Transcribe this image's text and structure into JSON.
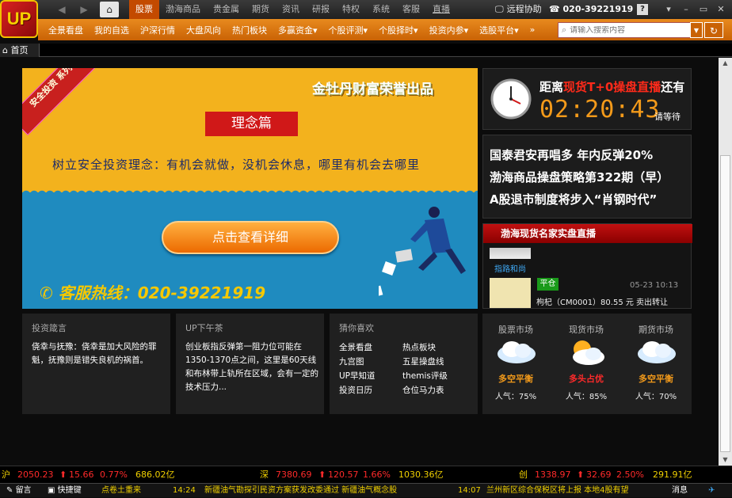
{
  "app": {
    "logo": "UP"
  },
  "topmenu": [
    "股票",
    "渤海商品",
    "贵金属",
    "期货",
    "资讯",
    "研报",
    "特权",
    "系统",
    "客服",
    "直播"
  ],
  "header": {
    "remote": "远程协助",
    "phone": "020-39221919",
    "help": "?"
  },
  "window_controls": [
    "▾",
    "–",
    "▭",
    "✕"
  ],
  "toolbar": [
    "全景看盘",
    "我的自选",
    "沪深行情",
    "大盘风向",
    "热门板块",
    "多赢资金▾",
    "个股评测▾",
    "个股择时▾",
    "投资内参▾",
    "选股平台▾",
    "»"
  ],
  "search": {
    "placeholder": "请输入搜索内容"
  },
  "tabs": {
    "home": "首页"
  },
  "banner": {
    "corner": "安全投资 系列",
    "subtitle": "金牡丹财富荣誉出品",
    "title": "理念篇",
    "slogan": "树立安全投资理念：有机会就做，没机会休息，哪里有机会去哪里",
    "cta": "点击查看详细",
    "hotline": "客服热线：020-39221919"
  },
  "countdown": {
    "prefix": "距离",
    "highlight": "现货T+0操盘直播",
    "suffix": "还有",
    "time": "02:20:43",
    "wait": "请等待"
  },
  "news": [
    "国泰君安再唱多 年内反弹20%",
    "渤海商品操盘策略第322期（早）",
    "A股退市制度将步入“肖钢时代”"
  ],
  "live": {
    "header": "渤海现货名家实盘直播",
    "name1": "指路和尚",
    "tag": "平仓",
    "time": "05-23 10:13",
    "message": "枸杞（CM0001）80.55 元 卖出转让"
  },
  "cards": {
    "quote": {
      "title": "投资箴言",
      "text": "侥幸与抚豫：侥幸是加大风险的罪魁，抚豫则是错失良机的祸首。"
    },
    "tea": {
      "title": "UP下午茶",
      "text": "创业板指反弹第一阻力位可能在1350-1370点之间，这里是60天线和布林带上轨所在区域，会有一定的技术压力..."
    },
    "guess": {
      "title": "猜你喜欢",
      "items": [
        "全景看盘",
        "热点板块",
        "九宫图",
        "五星操盘线",
        "UP早知道",
        "themis评级",
        "投资日历",
        "仓位马力表"
      ]
    }
  },
  "markets": [
    {
      "name": "股票市场",
      "status": "多空平衡",
      "popularity": "人气：75%",
      "icon": "cloud-icon",
      "color": "#f39a1a"
    },
    {
      "name": "现货市场",
      "status": "多头占优",
      "popularity": "人气：85%",
      "icon": "sun-cloud-icon",
      "color": "#ff2a2a"
    },
    {
      "name": "期货市场",
      "status": "多空平衡",
      "popularity": "人气：70%",
      "icon": "cloud-icon",
      "color": "#f39a1a"
    }
  ],
  "ticker": [
    {
      "label": "沪",
      "value": "2050.23",
      "change": "15.66",
      "pct": "0.77%",
      "amount": "686.02亿"
    },
    {
      "label": "深",
      "value": "7380.69",
      "change": "120.57",
      "pct": "1.66%",
      "amount": "1030.36亿"
    },
    {
      "label": "创",
      "value": "1338.97",
      "change": "32.69",
      "pct": "2.50%",
      "amount": "291.91亿"
    }
  ],
  "statusbar": {
    "msg": "留言",
    "shortcut": "快捷键",
    "marquee1": "点卷土重来",
    "t1": "14:24",
    "n1": "新疆油气勘探引民资方案获发改委通过 新疆油气概念股",
    "t2": "14:07",
    "n2": "兰州新区综合保税区将上报 本地4股有望",
    "news": "消息"
  },
  "colors": {
    "accent": "#e07a10",
    "up": "#ff2a2a",
    "gold": "#f0d000"
  }
}
